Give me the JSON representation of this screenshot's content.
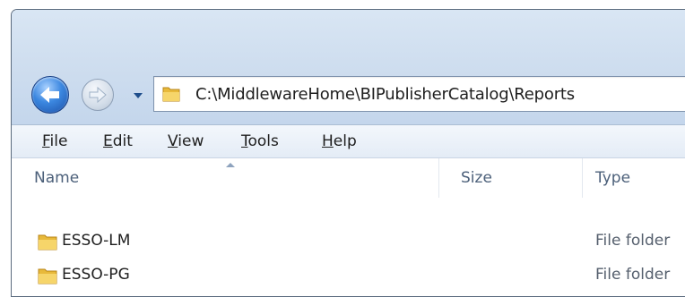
{
  "address": {
    "path": "C:\\MiddlewareHome\\BIPublisherCatalog\\Reports",
    "folder_icon": "folder-icon"
  },
  "nav": {
    "back_icon": "back-arrow-icon",
    "forward_icon": "forward-arrow-icon",
    "history_icon": "chevron-down-icon"
  },
  "menu": {
    "items": [
      {
        "first": "F",
        "rest": "ile"
      },
      {
        "first": "E",
        "rest": "dit"
      },
      {
        "first": "V",
        "rest": "iew"
      },
      {
        "first": "T",
        "rest": "ools"
      },
      {
        "first": "H",
        "rest": "elp"
      }
    ]
  },
  "columns": {
    "name": "Name",
    "size": "Size",
    "type": "Type",
    "sorted_by": "Name"
  },
  "files": [
    {
      "name": "ESSO-LM",
      "size": "",
      "type": "File folder",
      "icon": "folder-icon"
    },
    {
      "name": "ESSO-PG",
      "size": "",
      "type": "File folder",
      "icon": "folder-icon"
    }
  ],
  "colors": {
    "chrome": "#cfdeef",
    "accent": "#3b87e0",
    "header_text": "#4c607a",
    "folder": "#e8b93a"
  }
}
